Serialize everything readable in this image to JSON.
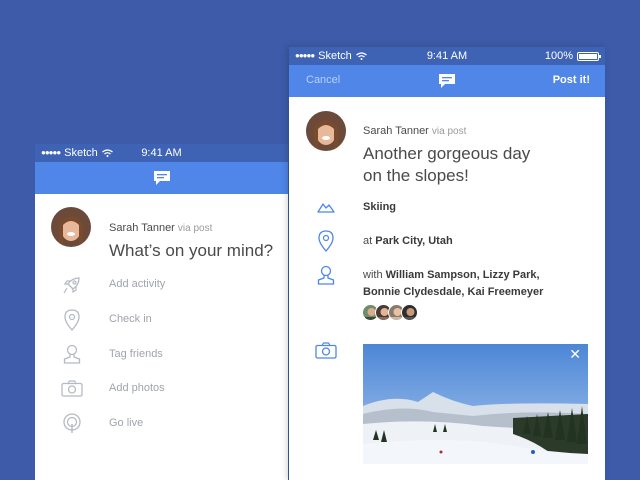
{
  "left_phone": {
    "status": {
      "carrier": "Sketch",
      "time": "9:41 AM"
    },
    "user": {
      "name": "Sarah Tanner",
      "via": "via post"
    },
    "prompt": "What’s on your mind?",
    "actions": [
      {
        "label": "Add activity",
        "icon": "rocket-icon"
      },
      {
        "label": "Check in",
        "icon": "location-pin-icon"
      },
      {
        "label": "Tag friends",
        "icon": "person-icon"
      },
      {
        "label": "Add photos",
        "icon": "camera-icon"
      },
      {
        "label": "Go live",
        "icon": "live-icon"
      }
    ]
  },
  "right_phone": {
    "status": {
      "carrier": "Sketch",
      "time": "9:41 AM",
      "battery": "100%"
    },
    "nav": {
      "cancel": "Cancel",
      "post": "Post it!"
    },
    "user": {
      "name": "Sarah Tanner",
      "via": "via post"
    },
    "post_text_line1": "Another gorgeous day",
    "post_text_line2": "on the slopes!",
    "activity": "Skiing",
    "location": {
      "prefix": "at",
      "place": "Park City, Utah"
    },
    "tagged": {
      "prefix": "with",
      "line1": "William Sampson, Lizzy Park,",
      "line2": "Bonnie Clydesdale, Kai Freemeyer"
    },
    "photo_close": "✕"
  },
  "colors": {
    "background": "#3d5ba9",
    "nav_bar": "#4f86e8",
    "status_bar": "#3f63b4",
    "accent_icon": "#4f86e8",
    "muted_icon": "#b5b9c1"
  }
}
